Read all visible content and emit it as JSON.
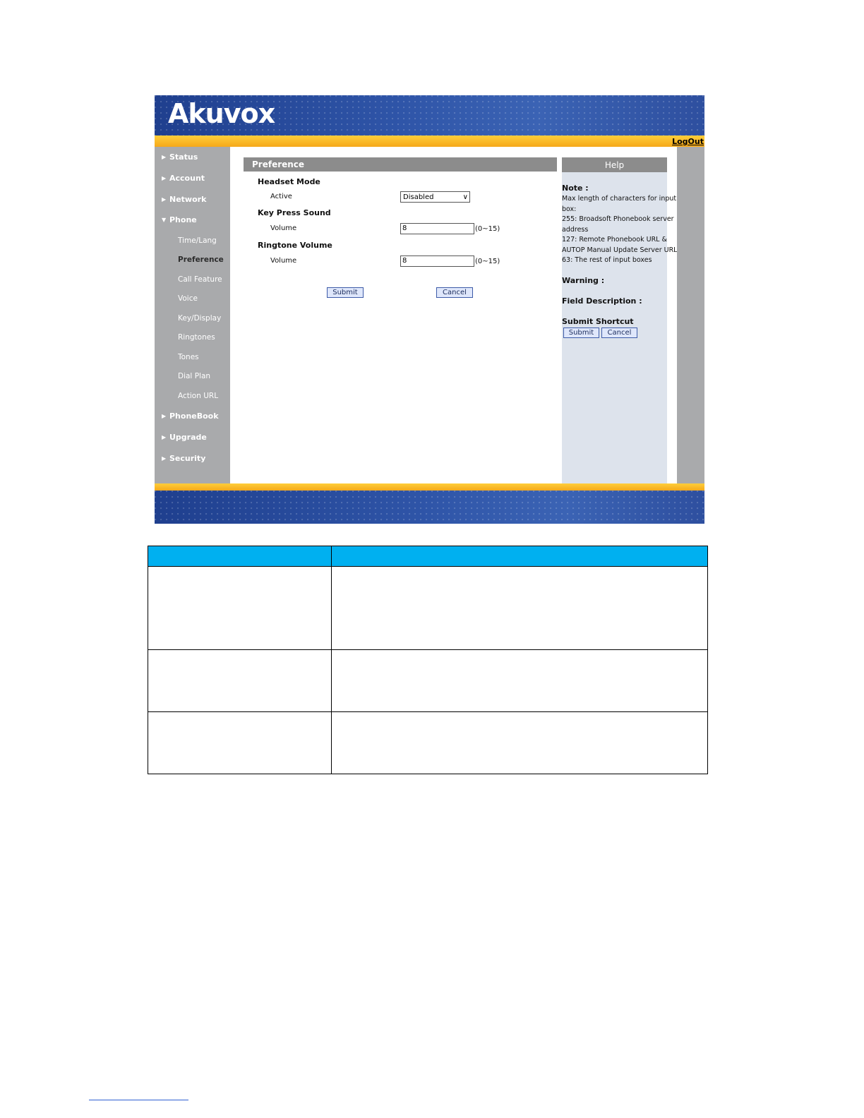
{
  "brand": {
    "logo_text": "Akuvox",
    "accent_orange": "#f5a81a",
    "banner_blue": "#2f55a8",
    "sidebar_gray": "#a9aaac"
  },
  "header": {
    "logout_label": "LogOut"
  },
  "sidebar": {
    "items": [
      {
        "label": "Status",
        "icon": "triangle-right-icon"
      },
      {
        "label": "Account",
        "icon": "triangle-right-icon"
      },
      {
        "label": "Network",
        "icon": "triangle-right-icon"
      },
      {
        "label": "Phone",
        "icon": "triangle-down-icon",
        "expanded": true
      }
    ],
    "phone_subitems": [
      "Time/Lang",
      "Preference",
      "Call Feature",
      "Voice",
      "Key/Display",
      "Ringtones",
      "Tones",
      "Dial Plan",
      "Action URL"
    ],
    "active_subitem": "Preference",
    "items_after": [
      {
        "label": "PhoneBook",
        "icon": "triangle-right-icon"
      },
      {
        "label": "Upgrade",
        "icon": "triangle-right-icon"
      },
      {
        "label": "Security",
        "icon": "triangle-right-icon"
      }
    ]
  },
  "main": {
    "title": "Preference",
    "headset": {
      "title": "Headset Mode",
      "field_label": "Active",
      "value": "Disabled"
    },
    "key_press": {
      "title": "Key Press Sound",
      "field_label": "Volume",
      "value": "8",
      "range": "(0~15)"
    },
    "ringtone": {
      "title": "Ringtone Volume",
      "field_label": "Volume",
      "value": "8",
      "range": "(0~15)"
    },
    "submit_label": "Submit",
    "cancel_label": "Cancel"
  },
  "help": {
    "title": "Help",
    "note_label": "Note :",
    "note_lines": [
      "Max length of characters for input",
      "box:",
      "255: Broadsoft Phonebook server",
      "address",
      "127: Remote Phonebook URL &",
      "AUTOP Manual Update Server URL",
      "63: The rest of input boxes"
    ],
    "warning_label": "Warning :",
    "field_description_label": "Field Description :",
    "submit_shortcut_label": "Submit Shortcut",
    "submit_label": "Submit",
    "cancel_label": "Cancel"
  },
  "doc_table": {
    "header_color": "#00b0f0"
  }
}
